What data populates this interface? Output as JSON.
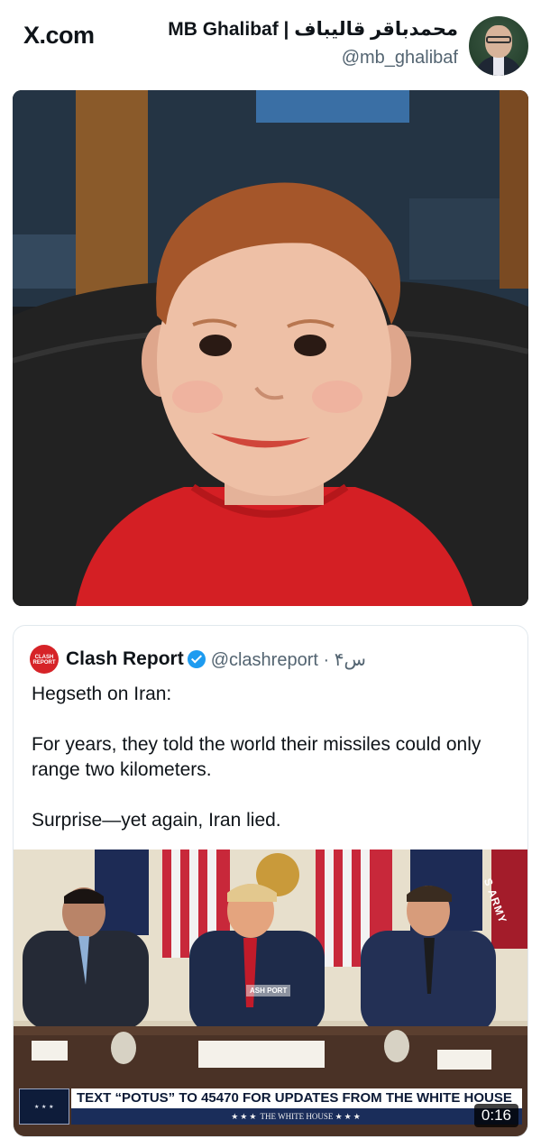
{
  "header": {
    "site_label": "X.com",
    "author_name": "MB Ghalibaf | محمدباقر قالیباف",
    "author_handle": "@mb_ghalibaf"
  },
  "quoted_tweet": {
    "name": "Clash Report",
    "handle_time": "@clashreport · ۴س",
    "avatar_text": "CLASH REPORT",
    "lines": [
      "Hegseth on Iran:",
      "For years, they told the world their missiles could only range two kilometers.",
      "Surprise—yet again, Iran lied."
    ],
    "video": {
      "banner": "TEXT “POTUS” TO 45470 FOR UPDATES FROM THE WHITE HOUSE",
      "banner_sub": "THE WHITE HOUSE",
      "duration": "0:16",
      "flag_text": "S ARMY",
      "watermark": "ASH PORT"
    }
  },
  "colors": {
    "accent": "#1d9bf0",
    "clash_red": "#d62328",
    "banner_navy": "#1a2d5a"
  }
}
